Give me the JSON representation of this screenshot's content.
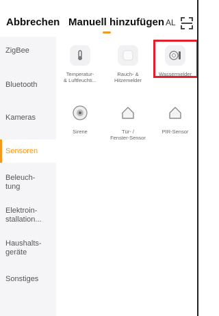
{
  "header": {
    "cancel_label": "Abbrechen",
    "tab_label": "Manuell hinzufügen",
    "ai_label": "AL",
    "accent_color": "#f39a1c"
  },
  "sidebar": {
    "items": [
      {
        "label": "ZigBee",
        "active": false
      },
      {
        "label": "Bluetooth",
        "active": false
      },
      {
        "label": "Kameras",
        "active": false
      },
      {
        "label": "Sensoren",
        "active": true
      },
      {
        "label": "Beleuch-\ntung",
        "active": false
      },
      {
        "label": "Elektroin-\nstallation...",
        "active": false
      },
      {
        "label": "Haushalts-\ngeräte",
        "active": false
      },
      {
        "label": "Sonstiges",
        "active": false
      }
    ]
  },
  "devices": [
    {
      "name": "Temperatur-\n& Luftfeuchti...",
      "icon": "thermometer-icon"
    },
    {
      "name": "Rauch- &\nHitzemelder",
      "icon": "smoke-detector-icon"
    },
    {
      "name": "Wassermelder",
      "icon": "water-sensor-icon"
    },
    {
      "name": "Sirene",
      "icon": "siren-icon"
    },
    {
      "name": "Tür- /\nFenster-Sensor",
      "icon": "door-window-sensor-icon"
    },
    {
      "name": "PIR-Sensor",
      "icon": "pir-sensor-icon"
    }
  ],
  "highlight_color": "#e0202c"
}
